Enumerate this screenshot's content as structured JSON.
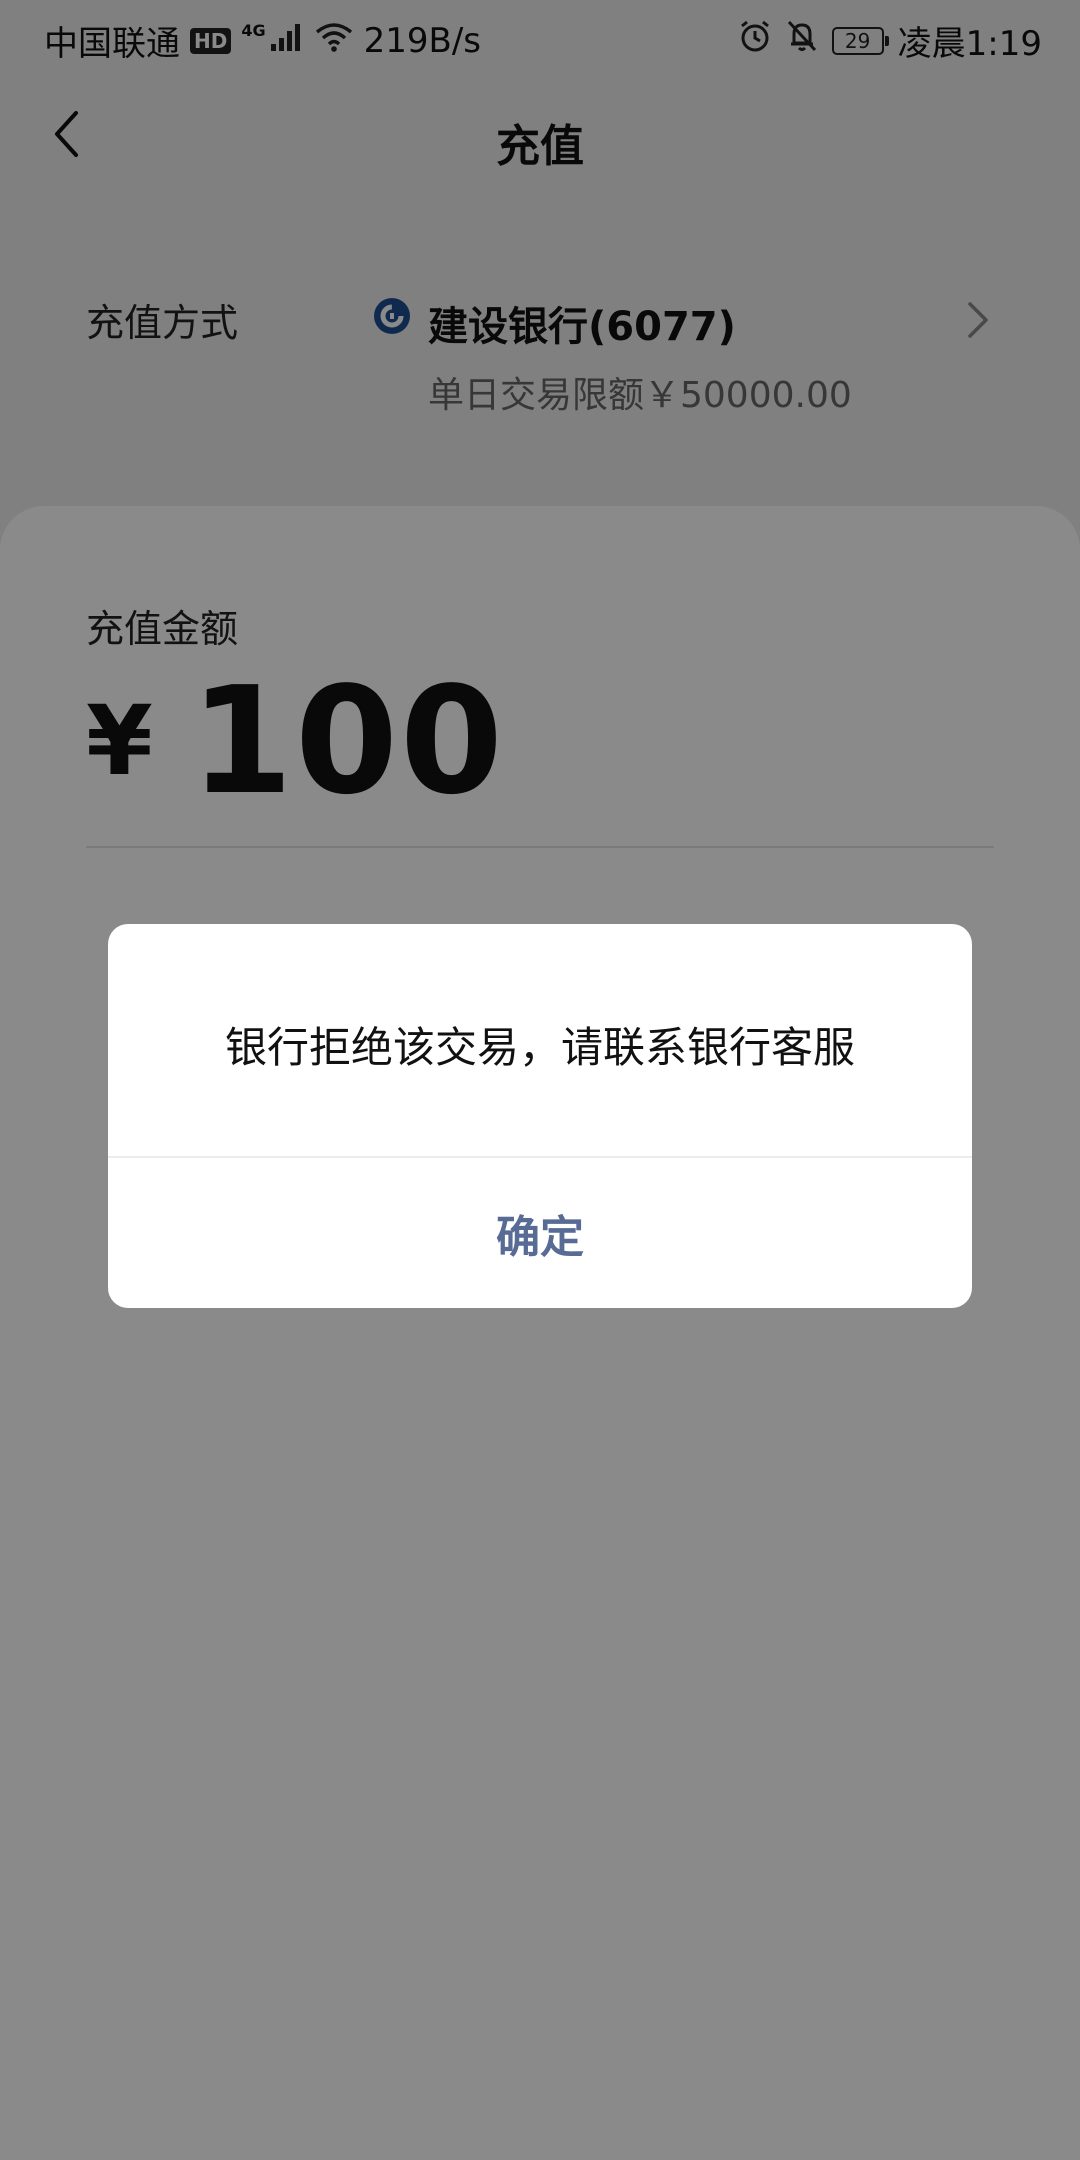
{
  "status_bar": {
    "carrier": "中国联通",
    "hd_badge": "HD",
    "network_type": "4G",
    "network_speed": "219B/s",
    "battery_level": "29",
    "time": "凌晨1:19"
  },
  "header": {
    "title": "充值",
    "back_icon": "chevron-left-icon"
  },
  "recharge_method": {
    "label": "充值方式",
    "bank_name": "建设银行(6077)",
    "daily_limit": "单日交易限额￥50000.00",
    "bank_icon": "ccb-bank-logo",
    "chevron_icon": "chevron-right-icon"
  },
  "amount": {
    "label": "充值金额",
    "currency": "¥",
    "value": "100"
  },
  "dialog": {
    "message": "银行拒绝该交易，请联系银行客服",
    "confirm_label": "确定"
  },
  "colors": {
    "page_background": "#ededed",
    "card_background": "#ffffff",
    "dialog_confirm": "#576b95",
    "bank_logo": "#1d4f91",
    "overlay": "rgba(0,0,0,0.46)"
  }
}
